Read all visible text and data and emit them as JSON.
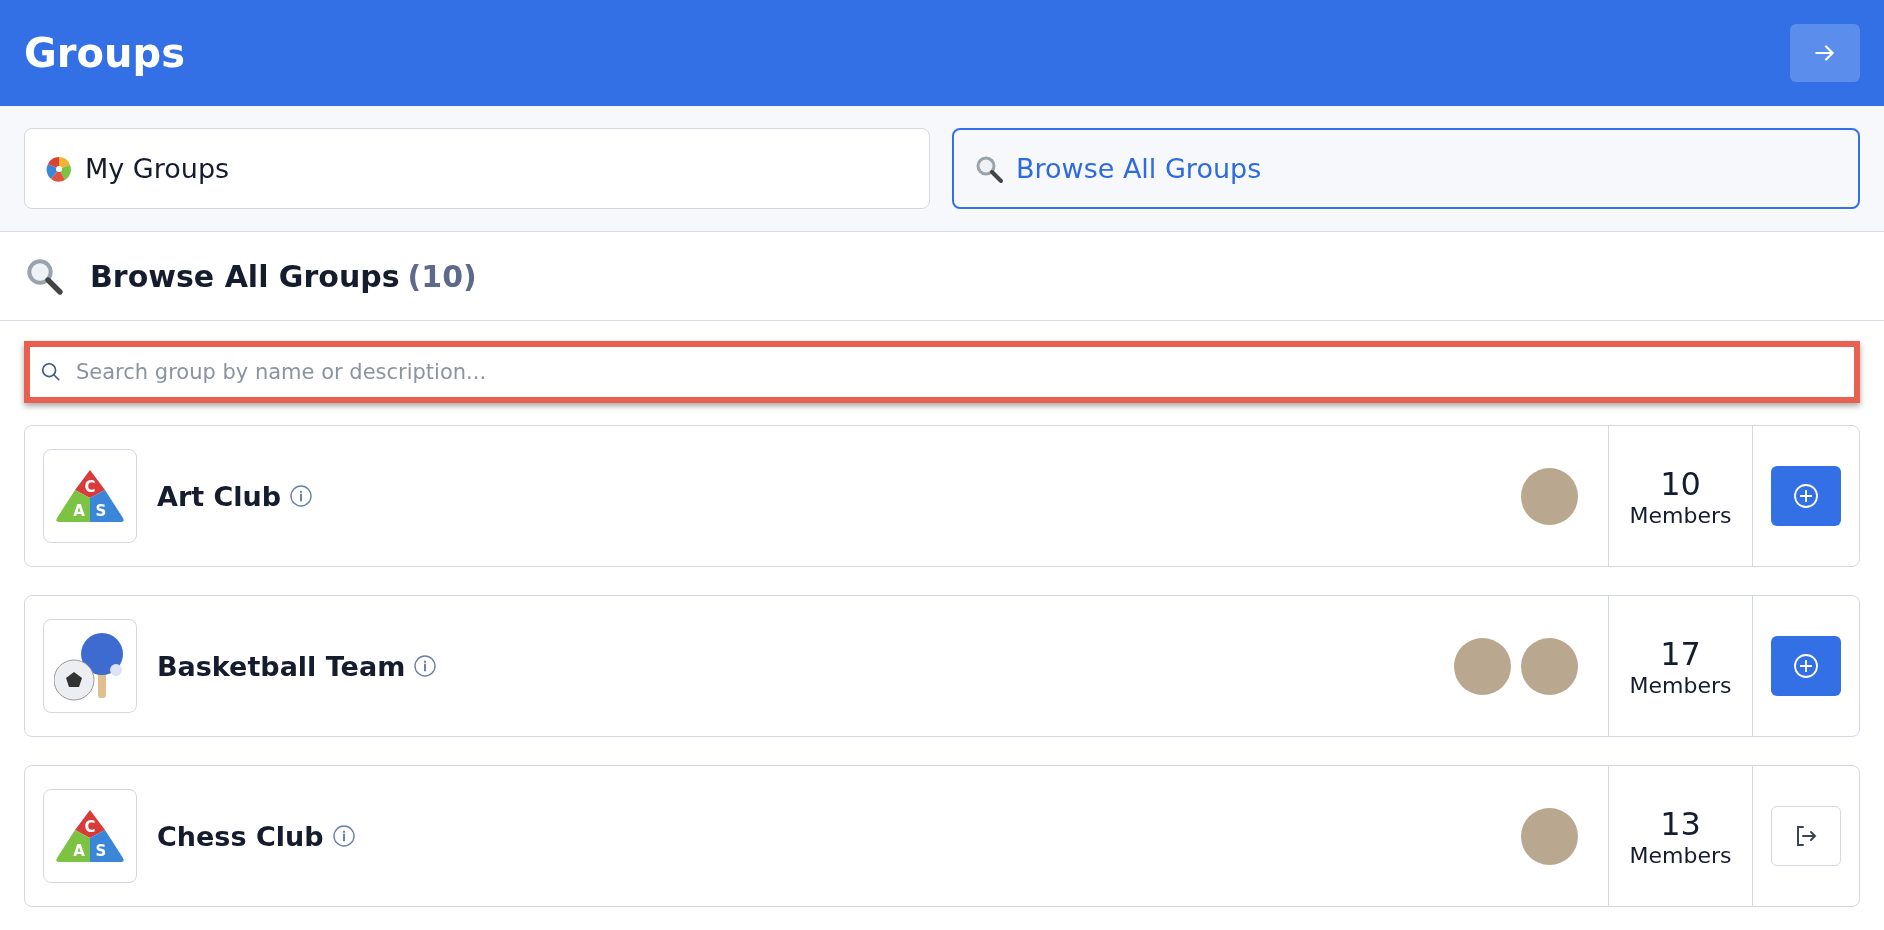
{
  "header": {
    "title": "Groups"
  },
  "tabs": [
    {
      "label": "My Groups",
      "kind": "pie",
      "selected": false
    },
    {
      "label": "Browse All Groups",
      "kind": "magnifier",
      "selected": true
    }
  ],
  "section": {
    "title": "Browse All Groups",
    "count": "(10)"
  },
  "search": {
    "placeholder": "Search group by name or description...",
    "highlighted": true
  },
  "groups": [
    {
      "name": "Art Club",
      "kind": "letters",
      "logo_letters": [
        "C",
        "A",
        "S"
      ],
      "members": [
        {
          "kind": "photo"
        }
      ],
      "count": "10",
      "count_label": "Members",
      "joined": false
    },
    {
      "name": "Basketball Team",
      "kind": "sports",
      "members": [
        {
          "kind": "photo"
        },
        {
          "kind": "photo"
        }
      ],
      "count": "17",
      "count_label": "Members",
      "joined": false
    },
    {
      "name": "Chess Club",
      "kind": "letters",
      "logo_letters": [
        "C",
        "A",
        "S"
      ],
      "members": [
        {
          "kind": "photo"
        }
      ],
      "count": "13",
      "count_label": "Members",
      "joined": true
    }
  ]
}
